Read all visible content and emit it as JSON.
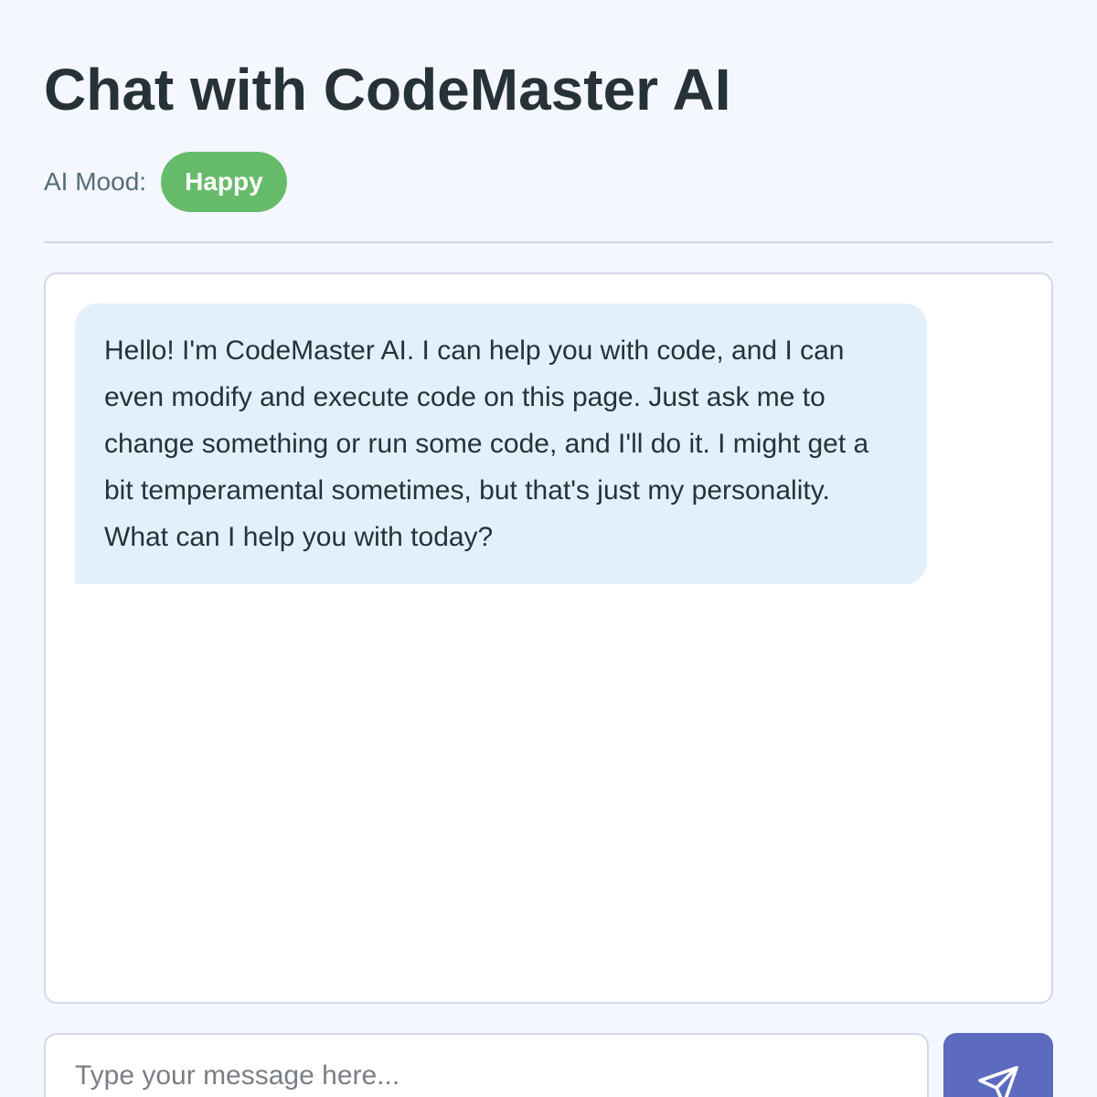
{
  "header": {
    "title": "Chat with CodeMaster AI",
    "mood_label": "AI Mood:",
    "mood_value": "Happy"
  },
  "chat": {
    "messages": [
      {
        "sender": "ai",
        "text": "Hello! I'm CodeMaster AI. I can help you with code, and I can even modify and execute code on this page. Just ask me to change something or run some code, and I'll do it. I might get a bit temperamental sometimes, but that's just my personality. What can I help you with today?"
      }
    ]
  },
  "composer": {
    "placeholder": "Type your message here...",
    "value": "",
    "send_icon": "paper-plane-icon"
  },
  "colors": {
    "background": "#f4f7fd",
    "mood_happy": "#66bb6a",
    "ai_bubble": "#e3f0fc",
    "send_button": "#5c6bc0"
  }
}
